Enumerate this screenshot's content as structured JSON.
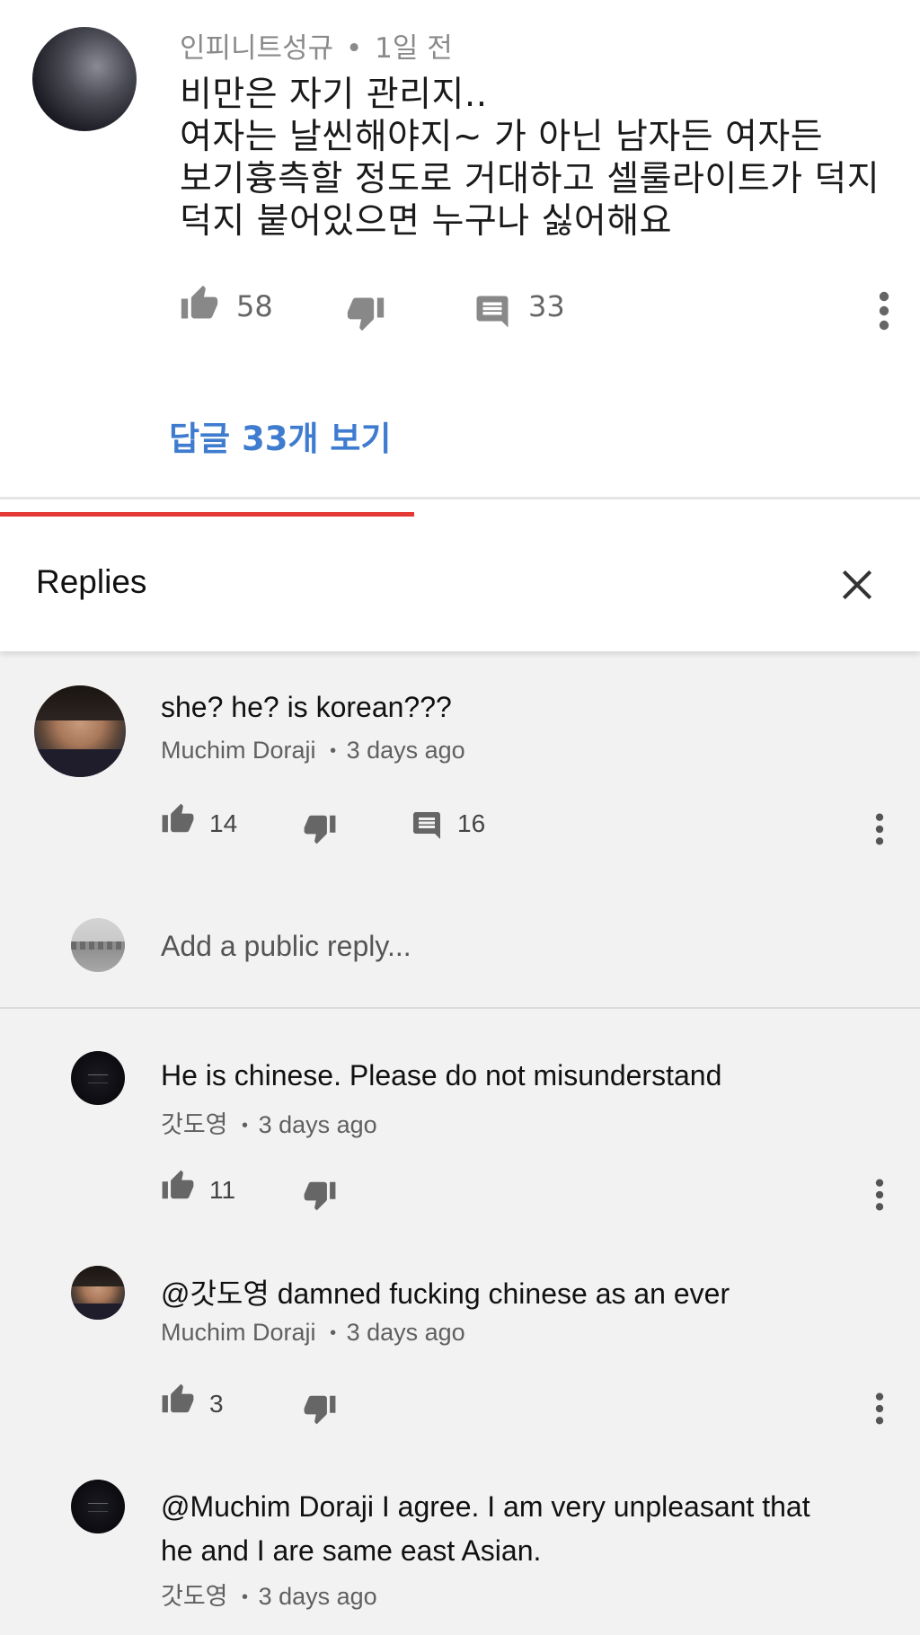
{
  "top_comment": {
    "author": "인피니트성규",
    "separator": "•",
    "time": "1일 전",
    "text_lines": [
      "비만은 자기 관리지..",
      "여자는 날씬해야지~ 가 아닌 남자든 여자든",
      "보기흉측할 정도로 거대하고 셀룰라이트가 덕지",
      "덕지 붙어있으면 누구나 싫어해요"
    ],
    "likes": "58",
    "replies_count": "33",
    "view_replies_label": "답글 33개 보기"
  },
  "replies_panel": {
    "title": "Replies",
    "reply_input_placeholder": "Add a public reply...",
    "progress_fraction": 0.45
  },
  "parent_reply": {
    "text": "she? he? is korean???",
    "author": "Muchim Doraji",
    "time": "3 days ago",
    "likes": "14",
    "replies_count": "16"
  },
  "replies": [
    {
      "text": "He is chinese. Please do not misunderstand",
      "author": "갓도영",
      "time": "3 days ago",
      "likes": "11"
    },
    {
      "text": "@갓도영 damned fucking chinese as an ever",
      "author": "Muchim Doraji",
      "time": "3 days ago",
      "likes": "3"
    },
    {
      "text_lines": [
        "@Muchim Doraji I agree. I am very unpleasant that",
        "he and I are same east Asian."
      ],
      "author": "갓도영",
      "time": "3 days ago"
    }
  ],
  "meta_separator": "•",
  "icons": {
    "like": "thumbs-up-icon",
    "dislike": "thumbs-down-icon",
    "reply": "comment-icon",
    "more": "more-vertical-icon",
    "close": "close-icon"
  },
  "colors": {
    "accent_link": "#3f7ccf",
    "progress": "#e53935",
    "panel_bg": "#f2f2f2"
  }
}
